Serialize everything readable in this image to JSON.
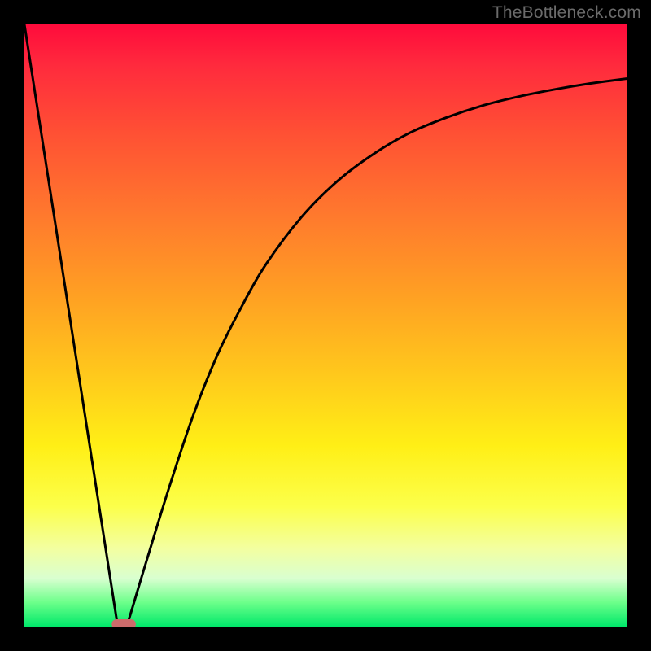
{
  "watermark": "TheBottleneck.com",
  "chart_data": {
    "type": "line",
    "title": "",
    "xlabel": "",
    "ylabel": "",
    "xlim": [
      0,
      100
    ],
    "ylim": [
      0,
      100
    ],
    "grid": false,
    "series": [
      {
        "name": "left-segment",
        "x": [
          0,
          15.5
        ],
        "y": [
          100,
          0
        ]
      },
      {
        "name": "right-curve",
        "x": [
          17,
          20,
          24,
          28,
          32,
          36,
          40,
          46,
          52,
          58,
          64,
          70,
          76,
          82,
          88,
          94,
          100
        ],
        "y": [
          0,
          10,
          23,
          35,
          45,
          53,
          60,
          68,
          74,
          78.5,
          82,
          84.5,
          86.5,
          88,
          89.2,
          90.2,
          91
        ]
      }
    ],
    "marker": {
      "name": "optimum-point",
      "x_range": [
        14.5,
        18.5
      ],
      "y": 0
    }
  }
}
